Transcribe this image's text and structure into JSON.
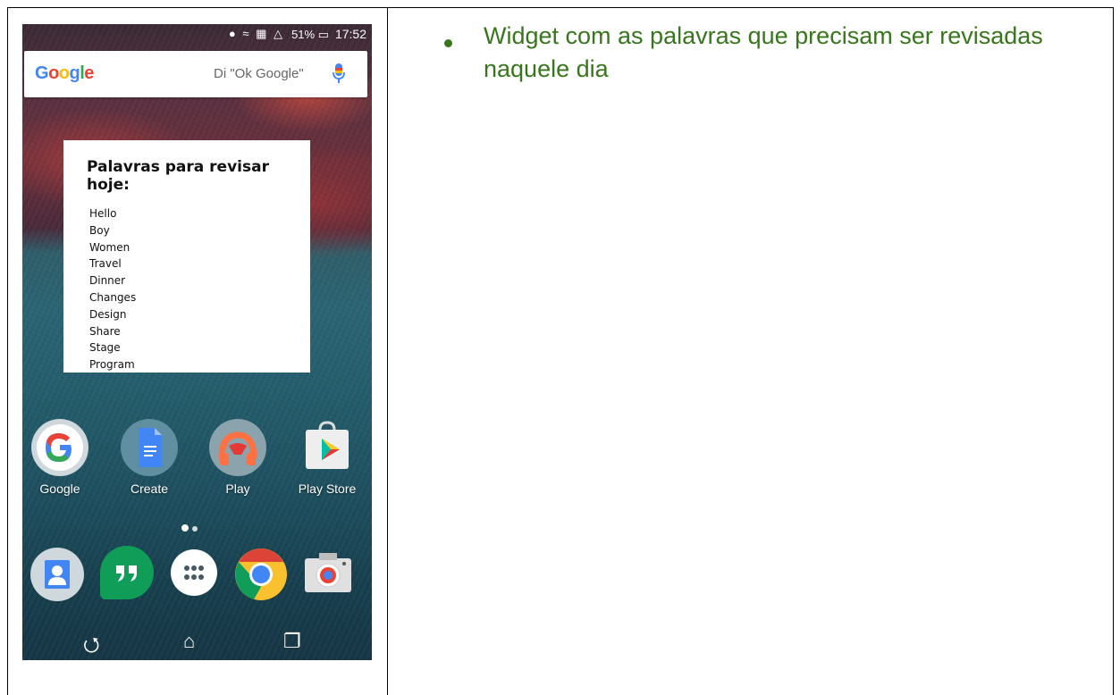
{
  "statusbar": {
    "battery": "51%",
    "time": "17:52"
  },
  "search": {
    "logo_parts": [
      "G",
      "o",
      "o",
      "g",
      "l",
      "e"
    ],
    "hint": "Di \"Ok Google\""
  },
  "widget": {
    "title": "Palavras para revisar hoje:",
    "words": [
      "Hello",
      "Boy",
      "Women",
      "Travel",
      "Dinner",
      "Changes",
      "Design",
      "Share",
      "Stage",
      "Program"
    ]
  },
  "apps": [
    {
      "label": "Google",
      "icon": "google-icon"
    },
    {
      "label": "Create",
      "icon": "docs-icon"
    },
    {
      "label": "Play",
      "icon": "play-music-icon"
    },
    {
      "label": "Play Store",
      "icon": "play-store-icon"
    }
  ],
  "dock": [
    "contacts-icon",
    "hangouts-icon",
    "app-drawer-icon",
    "chrome-icon",
    "camera-icon"
  ],
  "navbar": [
    "back-icon",
    "home-icon",
    "recents-icon"
  ],
  "note": {
    "text": "Widget com as palavras que precisam ser revisadas naquele dia"
  },
  "colors": {
    "note_green": "#38761d",
    "google_blue": "#4285f4",
    "google_red": "#ea4335",
    "google_yellow": "#fbbc05",
    "google_green": "#34a853"
  }
}
